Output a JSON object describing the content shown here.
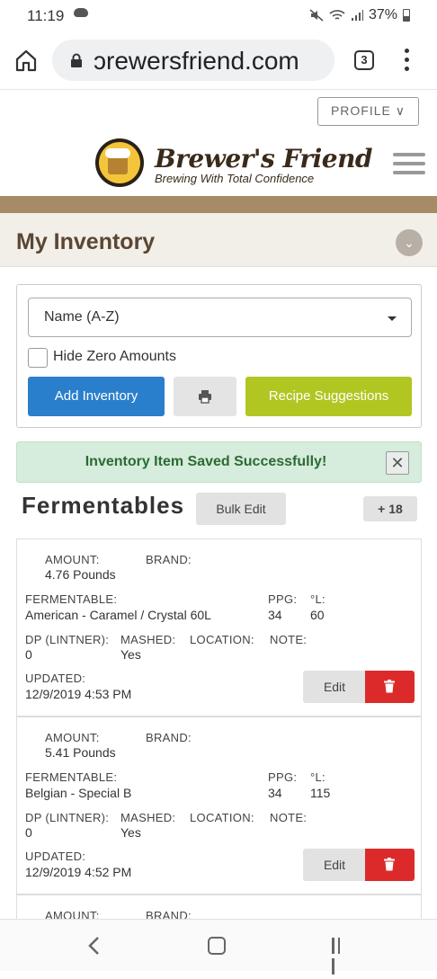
{
  "status_bar": {
    "time": "11:19",
    "battery": "37%"
  },
  "browser": {
    "url": "ɔrewersfriend.com",
    "tab_count": "3"
  },
  "header": {
    "profile_label": "PROFILE",
    "logo_title": "Brewer's Friend",
    "logo_tagline": "Brewing With Total Confidence"
  },
  "page": {
    "title": "My Inventory"
  },
  "filters": {
    "sort_value": "Name (A-Z)",
    "hide_zero_label": "Hide Zero Amounts",
    "add_inventory_label": "Add Inventory",
    "recipe_suggestions_label": "Recipe Suggestions"
  },
  "alert": {
    "message": "Inventory Item Saved Successfully!"
  },
  "section": {
    "title": "Fermentables",
    "bulk_edit_label": "Bulk Edit",
    "add_count_label": "+ 18"
  },
  "labels": {
    "amount": "AMOUNT:",
    "brand": "BRAND:",
    "fermentable": "FERMENTABLE:",
    "ppg": "PPG:",
    "lovibond": "°L:",
    "dp": "DP (LINTNER):",
    "mashed": "MASHED:",
    "location": "LOCATION:",
    "note": "NOTE:",
    "updated": "UPDATED:",
    "edit": "Edit"
  },
  "items": [
    {
      "amount": "4.76 Pounds",
      "fermentable": "American - Caramel / Crystal 60L",
      "ppg": "34",
      "lovibond": "60",
      "dp": "0",
      "mashed": "Yes",
      "updated": "12/9/2019 4:53 PM"
    },
    {
      "amount": "5.41 Pounds",
      "fermentable": "Belgian - Special B",
      "ppg": "34",
      "lovibond": "115",
      "dp": "0",
      "mashed": "Yes",
      "updated": "12/9/2019 4:52 PM"
    }
  ],
  "colors": {
    "brand_brown": "#a68b67",
    "primary_blue": "#2a7fcc",
    "lime": "#b2c621",
    "danger_red": "#dc2a2a",
    "success_bg": "#d6ecdc",
    "success_text": "#2a6b33"
  }
}
